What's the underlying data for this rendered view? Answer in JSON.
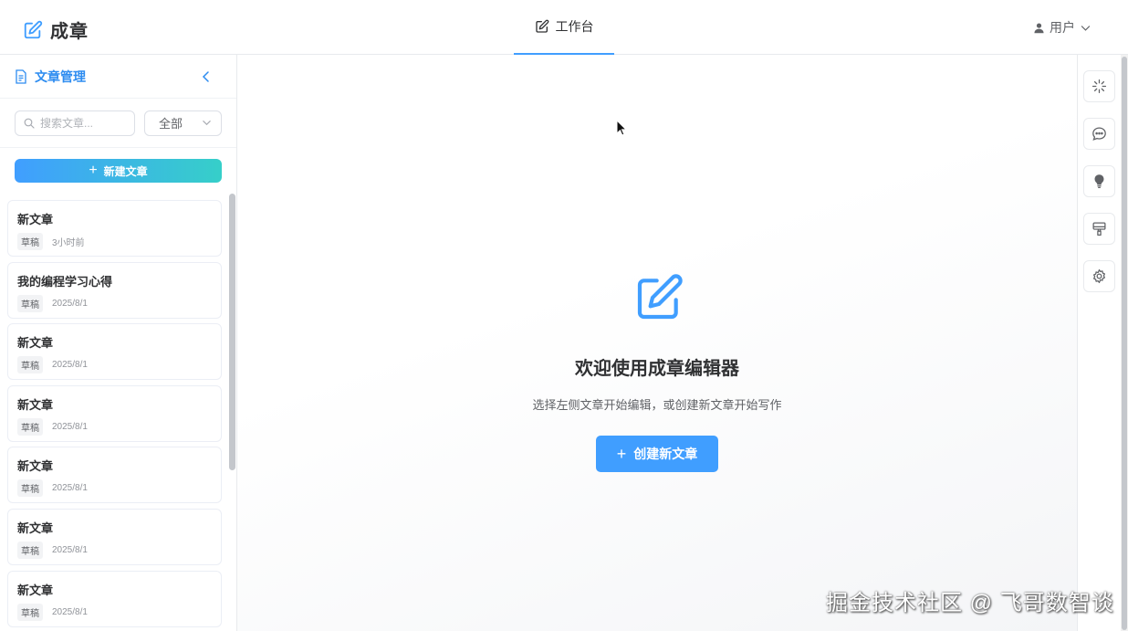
{
  "header": {
    "brand_title": "成章",
    "brand_icon": "edit-square-icon",
    "nav_tab_label": "工作台",
    "user_label": "用户"
  },
  "sidebar": {
    "title": "文章管理",
    "search_placeholder": "搜索文章...",
    "filter_selected": "全部",
    "new_button_label": "新建文章",
    "articles": [
      {
        "title": "新文章",
        "tag": "草稿",
        "time": "3小时前"
      },
      {
        "title": "我的编程学习心得",
        "tag": "草稿",
        "time": "2025/8/1"
      },
      {
        "title": "新文章",
        "tag": "草稿",
        "time": "2025/8/1"
      },
      {
        "title": "新文章",
        "tag": "草稿",
        "time": "2025/8/1"
      },
      {
        "title": "新文章",
        "tag": "草稿",
        "time": "2025/8/1"
      },
      {
        "title": "新文章",
        "tag": "草稿",
        "time": "2025/8/1"
      },
      {
        "title": "新文章",
        "tag": "草稿",
        "time": "2025/8/1"
      }
    ]
  },
  "main": {
    "welcome_title": "欢迎使用成章编辑器",
    "welcome_subtitle": "选择左侧文章开始编辑，或创建新文章开始写作",
    "create_button_label": "创建新文章"
  },
  "toolbar": {
    "tools": [
      "sparkle-icon",
      "chat-icon",
      "lightbulb-icon",
      "format-painter-icon",
      "settings-icon"
    ]
  },
  "watermark": "掘金技术社区 @ 飞哥数智谈",
  "colors": {
    "accent": "#409eff",
    "gradient_end": "#36cfc9",
    "text": "#303133"
  }
}
